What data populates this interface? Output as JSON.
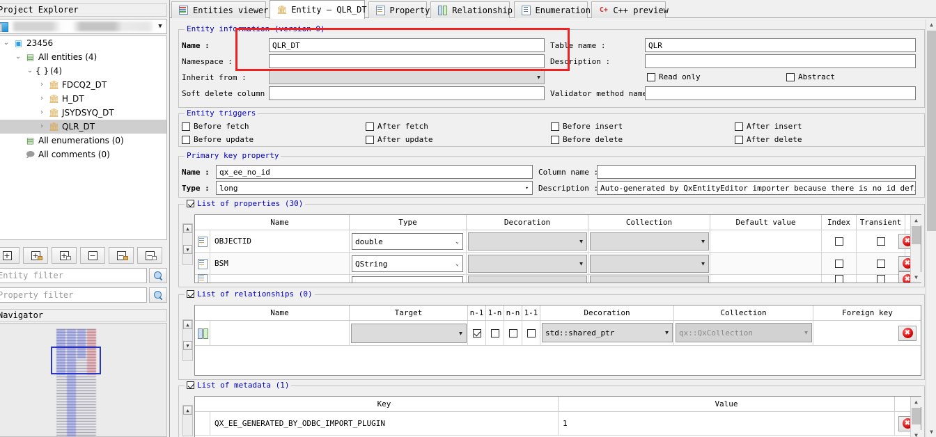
{
  "left_panel": {
    "title": "Project Explorer",
    "project_combo": {
      "value": "",
      "icon": "project-icon",
      "arrow": "▼"
    },
    "tree": [
      {
        "label": "23456",
        "depth": 0,
        "twisty": "⌄",
        "icon": "project-icon",
        "selected": false
      },
      {
        "label": "All entities (4)",
        "depth": 1,
        "twisty": "⌄",
        "icon": "entities-icon",
        "selected": false
      },
      {
        "label": "(4)",
        "depth": 2,
        "twisty": "⌄",
        "icon": "namespace-icon",
        "selected": false,
        "prefix": "{ }"
      },
      {
        "label": "FDCQ2_DT",
        "depth": 3,
        "twisty": "›",
        "icon": "entity-icon",
        "selected": false
      },
      {
        "label": "H_DT",
        "depth": 3,
        "twisty": "›",
        "icon": "entity-icon",
        "selected": false
      },
      {
        "label": "JSYDSYQ_DT",
        "depth": 3,
        "twisty": "›",
        "icon": "entity-icon",
        "selected": false
      },
      {
        "label": "QLR_DT",
        "depth": 3,
        "twisty": "›",
        "icon": "entity-icon",
        "selected": true
      },
      {
        "label": "All enumerations (0)",
        "depth": 1,
        "twisty": "",
        "icon": "enumerations-icon",
        "selected": false
      },
      {
        "label": "All comments (0)",
        "depth": 1,
        "twisty": "",
        "icon": "comments-icon",
        "selected": false
      }
    ],
    "toolbar": [
      {
        "name": "add-entity-button",
        "glyph": "+",
        "badge": "none"
      },
      {
        "name": "add-entity-db-button",
        "glyph": "+",
        "badge": "gold"
      },
      {
        "name": "add-property-button",
        "glyph": "+",
        "badge": "lines"
      },
      {
        "name": "remove-entity-button",
        "glyph": "−",
        "badge": "none"
      },
      {
        "name": "remove-entity-db-button",
        "glyph": "−",
        "badge": "gold"
      },
      {
        "name": "remove-property-button",
        "glyph": "−",
        "badge": "lines"
      }
    ],
    "entity_filter": {
      "value": "",
      "placeholder": "Entity filter"
    },
    "property_filter": {
      "value": "",
      "placeholder": "Property filter"
    },
    "navigator_title": "Navigator"
  },
  "tabs": [
    {
      "label": "Entities viewer",
      "icon": "entities-viewer-icon",
      "active": false
    },
    {
      "label": "Entity – QLR_DT",
      "icon": "entity-icon",
      "active": true
    },
    {
      "label": "Property",
      "icon": "property-icon",
      "active": false
    },
    {
      "label": "Relationship",
      "icon": "relationship-icon",
      "active": false
    },
    {
      "label": "Enumeration",
      "icon": "enumeration-icon",
      "active": false
    },
    {
      "label": "C++ preview",
      "icon": "cpp-preview-icon",
      "active": false
    }
  ],
  "entity_information": {
    "title": "Entity information (version 0)",
    "name_label": "Name :",
    "name_value": "QLR_DT",
    "table_name_label": "Table name :",
    "table_name_value": "QLR",
    "namespace_label": "Namespace :",
    "namespace_value": "",
    "description_label": "Description :",
    "description_value": "",
    "inherit_from_label": "Inherit from :",
    "inherit_from_value": "",
    "read_only_label": "Read only",
    "read_only_checked": false,
    "abstract_label": "Abstract",
    "abstract_checked": false,
    "soft_delete_label": "Soft delete column :",
    "soft_delete_value": "",
    "validator_label": "Validator method name :",
    "validator_value": ""
  },
  "entity_triggers": {
    "title": "Entity triggers",
    "items": [
      {
        "label": "Before fetch",
        "checked": false
      },
      {
        "label": "After fetch",
        "checked": false
      },
      {
        "label": "Before insert",
        "checked": false
      },
      {
        "label": "After insert",
        "checked": false
      },
      {
        "label": "Before update",
        "checked": false
      },
      {
        "label": "After update",
        "checked": false
      },
      {
        "label": "Before delete",
        "checked": false
      },
      {
        "label": "After delete",
        "checked": false
      }
    ]
  },
  "primary_key_property": {
    "title": "Primary key property",
    "name_label": "Name :",
    "name_value": "qx_ee_no_id",
    "column_name_label": "Column name :",
    "column_name_value": "",
    "type_label": "Type :",
    "type_value": "long",
    "description_label": "Description :",
    "description_value": "Auto-generated by QxEntityEditor importer because there is no id defined"
  },
  "list_of_properties": {
    "title": "List of properties (30)",
    "checked": true,
    "columns": [
      "Name",
      "Type",
      "Decoration",
      "Collection",
      "Default value",
      "Index",
      "Transient"
    ],
    "rows": [
      {
        "name": "OBJECTID",
        "type": "double",
        "decoration": "",
        "collection": "",
        "default_value": "",
        "index": false,
        "transient": false
      },
      {
        "name": "BSM",
        "type": "QString",
        "decoration": "",
        "collection": "",
        "default_value": "",
        "index": false,
        "transient": false
      }
    ]
  },
  "list_of_relationships": {
    "title": "List of relationships (0)",
    "checked": true,
    "columns": [
      "Name",
      "Target",
      "n-1",
      "1-n",
      "n-n",
      "1-1",
      "Decoration",
      "Collection",
      "Foreign key"
    ],
    "rows": [
      {
        "name": "",
        "target": "",
        "n_1": true,
        "one_n": false,
        "n_n": false,
        "one_1": false,
        "decoration": "std::shared_ptr",
        "collection": "qx::QxCollection",
        "foreign_key": ""
      }
    ]
  },
  "list_of_metadata": {
    "title": "List of metadata (1)",
    "checked": true,
    "columns": [
      "Key",
      "Value"
    ],
    "rows": [
      {
        "key": "QX_EE_GENERATED_BY_ODBC_IMPORT_PLUGIN",
        "value": "1"
      }
    ]
  },
  "icons": {
    "delete": "✖",
    "caret_down": "▼",
    "caret_down_thin": "⌄",
    "arrow_up": "▲",
    "arrow_down": "▼",
    "chevron_up": "⌃",
    "chevron_down": "⌄"
  },
  "colors": {
    "group_title": "#0000c8",
    "highlight_box": "#ee2222",
    "selection": "#cfcfcf",
    "delete_red": "#c90000"
  }
}
